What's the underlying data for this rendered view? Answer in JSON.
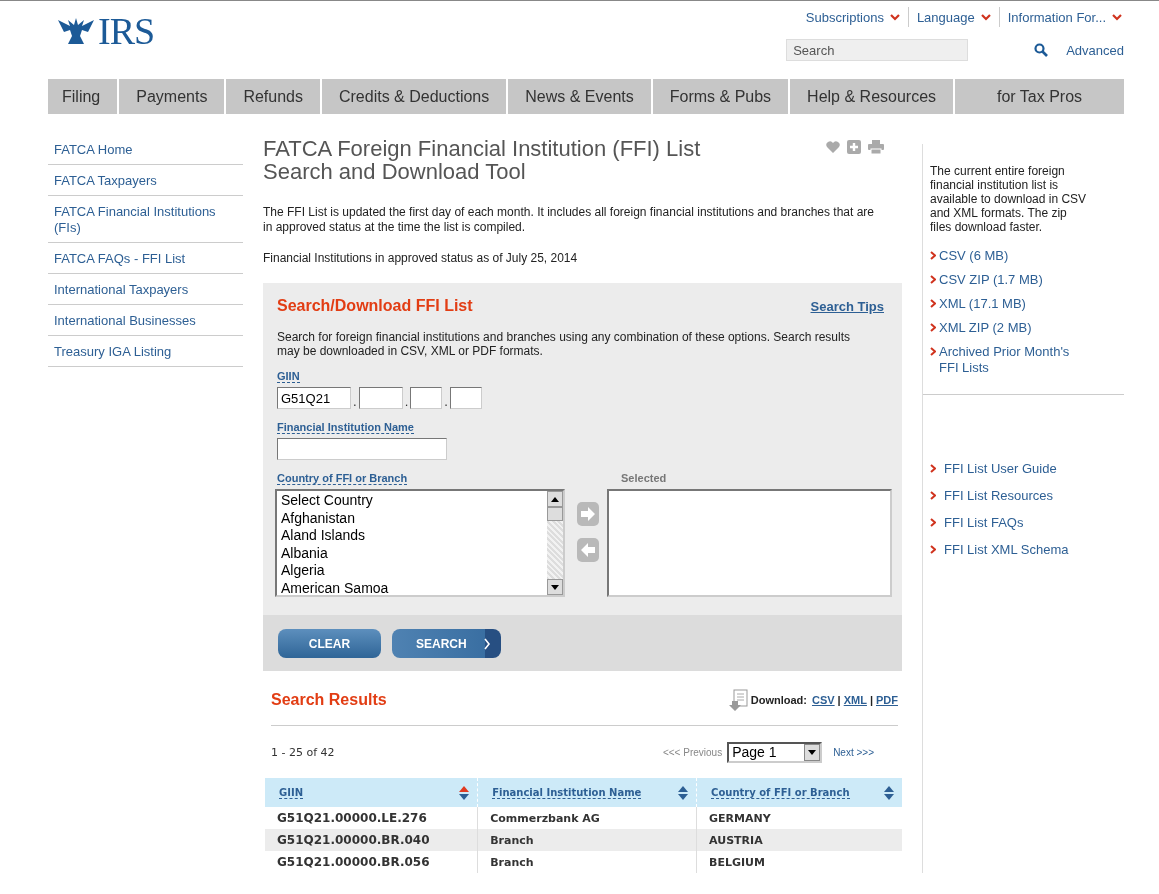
{
  "header": {
    "logo_text": "IRS",
    "top_links": [
      {
        "label": "Subscriptions"
      },
      {
        "label": "Language"
      },
      {
        "label": "Information For..."
      }
    ],
    "search": {
      "placeholder": "Search"
    },
    "advanced": "Advanced"
  },
  "nav": [
    {
      "label": "Filing"
    },
    {
      "label": "Payments"
    },
    {
      "label": "Refunds"
    },
    {
      "label": "Credits & Deductions"
    },
    {
      "label": "News & Events"
    },
    {
      "label": "Forms & Pubs"
    },
    {
      "label": "Help & Resources"
    },
    {
      "label": "for Tax Pros"
    }
  ],
  "sidebar": [
    "FATCA Home",
    "FATCA Taxpayers",
    "FATCA Financial Institutions (FIs)",
    "FATCA FAQs - FFI List",
    "International Taxpayers",
    "International Businesses",
    "Treasury IGA Listing"
  ],
  "main": {
    "title": "FATCA Foreign Financial Institution (FFI) List Search and Download Tool",
    "intro": "The FFI List is updated the first day of each month. It includes all foreign financial institutions and branches that are in approved status at the time the list is compiled.",
    "approved_note": "Financial Institutions in approved status as of July 25, 2014",
    "search_panel": {
      "heading": "Search/Download FFI List",
      "tips": "Search Tips",
      "description": "Search for foreign financial institutions and branches using any combination of these options. Search results may be downloaded in CSV, XML or PDF formats.",
      "giin_label": "GIIN",
      "giin_value": "G51Q21",
      "giin_separator": ".",
      "name_label": "Financial Institution Name",
      "country_label": "Country of FFI or Branch",
      "countries": [
        "Select Country",
        "Afghanistan",
        "Aland Islands",
        "Albania",
        "Algeria",
        "American Samoa"
      ],
      "selected_label": "Selected",
      "clear_button": "CLEAR",
      "search_button": "SEARCH"
    },
    "results": {
      "heading": "Search Results",
      "download_label": "Download:",
      "formats": [
        "CSV",
        "XML",
        "PDF"
      ],
      "separator": "|",
      "range": "1 - 25 of 42",
      "previous": {
        "label": "<<< Previous",
        "disabled": true
      },
      "page": "Page 1",
      "next": {
        "label": "Next >>>",
        "disabled": false
      },
      "columns": [
        {
          "label": "GIIN",
          "sorted": true
        },
        {
          "label": "Financial Institution Name",
          "sorted": false
        },
        {
          "label": "Country of FFI or Branch",
          "sorted": false
        }
      ],
      "rows": [
        [
          "G51Q21.00000.LE.276",
          "Commerzbank AG",
          "GERMANY"
        ],
        [
          "G51Q21.00000.BR.040",
          "Branch",
          "AUSTRIA"
        ],
        [
          "G51Q21.00000.BR.056",
          "Branch",
          "BELGIUM"
        ]
      ]
    }
  },
  "right": {
    "blurb": "The current entire foreign financial institution list is available to download in CSV and XML formats. The zip files download faster.",
    "downloads": [
      "CSV (6 MB)",
      "CSV ZIP (1.7 MB)",
      "XML (17.1 MB)",
      "XML ZIP (2 MB)",
      "Archived Prior Month's FFI Lists"
    ],
    "resources": [
      "FFI List User Guide",
      "FFI List Resources",
      "FFI List FAQs",
      "FFI List XML Schema"
    ]
  }
}
